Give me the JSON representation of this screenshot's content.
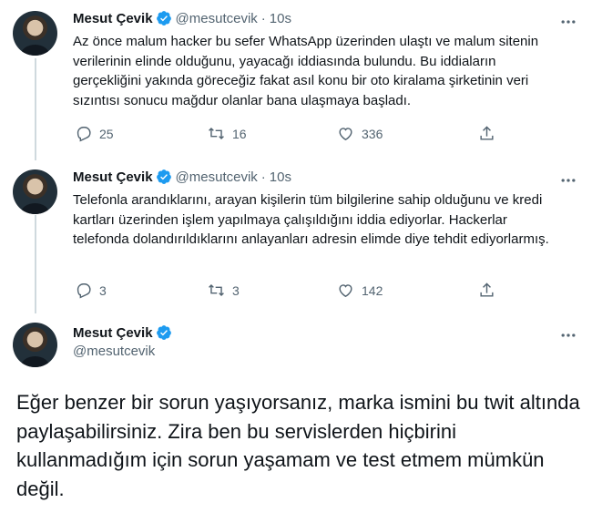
{
  "tweets": [
    {
      "name": "Mesut Çevik",
      "handle": "@mesutcevik",
      "separator": "·",
      "time": "10s",
      "text": "Az önce malum hacker bu sefer WhatsApp üzerinden ulaştı ve malum sitenin verilerinin elinde olduğunu, yayacağı iddiasında bulundu. Bu iddiaların gerçekliğini yakında göreceğiz fakat asıl konu bir oto kiralama şirketinin veri sızıntısı sonucu mağdur olanlar bana ulaşmaya başladı.",
      "replies": "25",
      "retweets": "16",
      "likes": "336"
    },
    {
      "name": "Mesut Çevik",
      "handle": "@mesutcevik",
      "separator": "·",
      "time": "10s",
      "text": "Telefonla arandıklarını, arayan kişilerin tüm bilgilerine sahip olduğunu ve kredi kartları üzerinden işlem yapılmaya çalışıldığını iddia ediyorlar. Hackerlar telefonda dolandırıldıklarını anlayanları adresin elimde diye tehdit ediyorlarmış.",
      "replies": "3",
      "retweets": "3",
      "likes": "142"
    }
  ],
  "main_tweet": {
    "name": "Mesut Çevik",
    "handle": "@mesutcevik",
    "text": "Eğer benzer bir sorun yaşıyorsanız, marka ismini bu twit altında paylaşabilirsiniz. Zira ben bu servislerden hiçbirini kullanmadığım için sorun yaşamam ve test etmem mümkün değil."
  },
  "colors": {
    "verified_badge": "#1d9bf0",
    "secondary_text": "#536471",
    "thread_line": "#cfd9de"
  },
  "icons": [
    "verified-icon",
    "more-icon",
    "reply-icon",
    "retweet-icon",
    "like-icon",
    "share-icon"
  ]
}
